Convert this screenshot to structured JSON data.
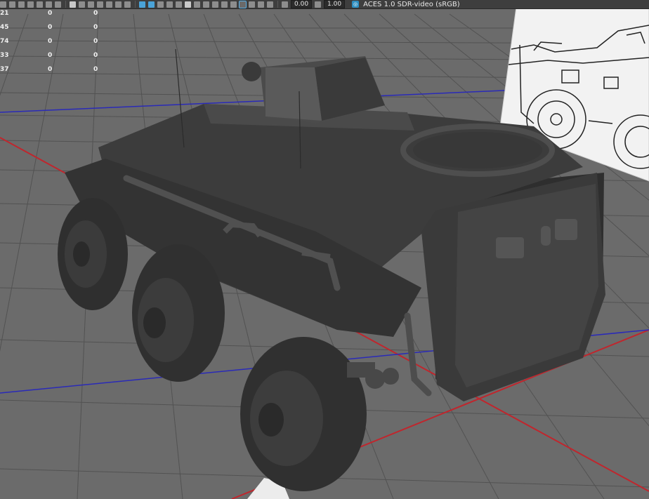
{
  "toolbar": {
    "field_a": "0.00",
    "field_b": "1.00",
    "color_space": "ACES 1.0 SDR-video (sRGB)",
    "icons": [
      "select-icon",
      "grid-icon",
      "camera-icon",
      "wireframe-icon",
      "smooth-shade-icon",
      "textured-icon",
      "lights-icon",
      "shadows-icon",
      "isolate-icon",
      "xray-icon",
      "resolution-gate-icon",
      "exposure-icon",
      "gamma-icon",
      "color-management-icon"
    ]
  },
  "hud": {
    "rows": [
      {
        "label": "21",
        "v1": "0",
        "v2": "0"
      },
      {
        "label": "45",
        "v1": "0",
        "v2": "0"
      },
      {
        "label": "74",
        "v1": "0",
        "v2": "0"
      },
      {
        "label": "33",
        "v1": "0",
        "v2": "0"
      },
      {
        "label": "37",
        "v1": "0",
        "v2": "0"
      }
    ]
  },
  "colors": {
    "viewport_bg": "#6b6b6b",
    "grid": "#4f4f4f",
    "axis_x": "#c0262d",
    "axis_z": "#2a2ab8",
    "model": "#3f3f3f"
  }
}
